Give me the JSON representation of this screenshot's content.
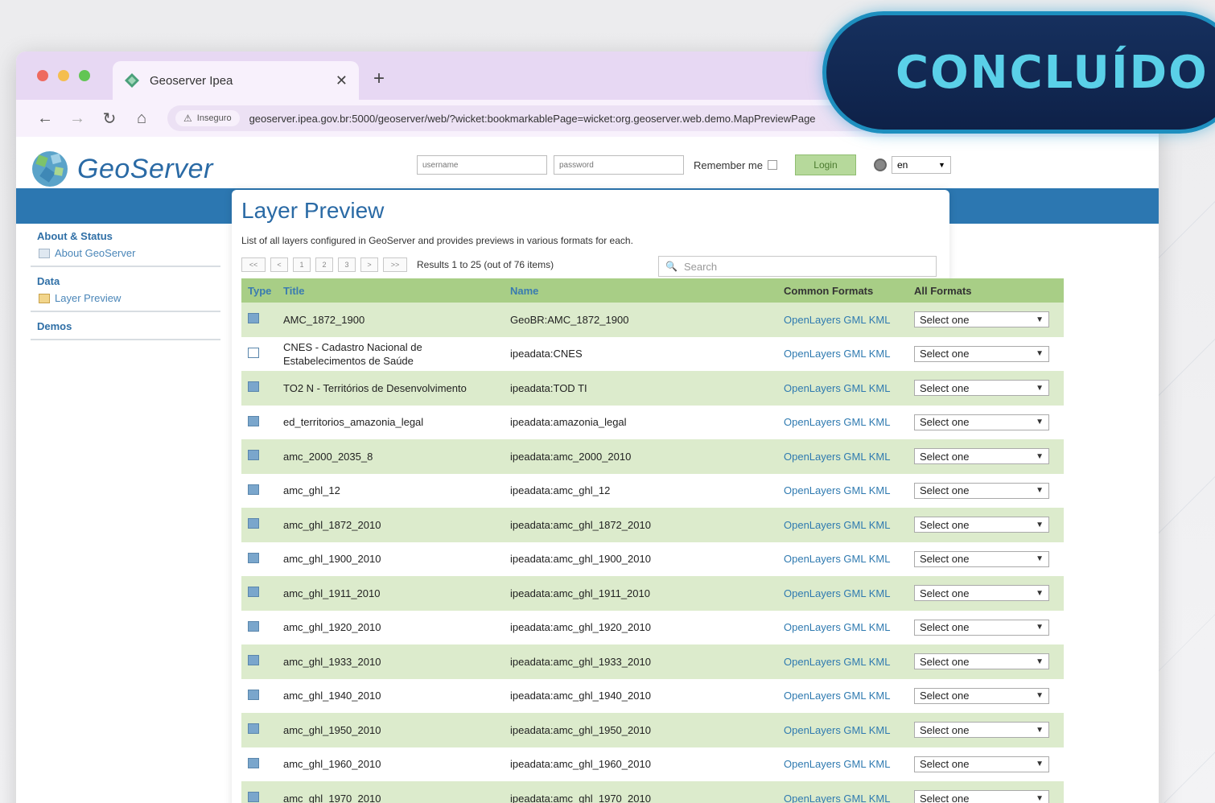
{
  "overlay": {
    "badge_text": "CONCLUÍDO"
  },
  "browser": {
    "tab_title": "Geoserver Ipea",
    "security_label": "Inseguro",
    "url": "geoserver.ipea.gov.br:5000/geoserver/web/?wicket:bookmarkablePage=wicket:org.geoserver.web.demo.MapPreviewPage"
  },
  "header": {
    "logo_text": "GeoServer",
    "username_placeholder": "username",
    "password_placeholder": "password",
    "remember_label": "Remember me",
    "login_label": "Login",
    "lang_value": "en"
  },
  "sidebar": {
    "sections": [
      {
        "title": "About & Status",
        "items": [
          "About GeoServer"
        ]
      },
      {
        "title": "Data",
        "items": [
          "Layer Preview"
        ]
      },
      {
        "title": "Demos",
        "items": []
      }
    ]
  },
  "main": {
    "title": "Layer Preview",
    "description": "List of all layers configured in GeoServer and provides previews in various formats for each.",
    "pager": {
      "buttons": [
        "<<",
        "<",
        "1",
        "2",
        "3",
        ">",
        ">>"
      ],
      "info": "Results 1 to 25 (out of 76 items)"
    },
    "search_placeholder": "Search",
    "columns": {
      "type": "Type",
      "title": "Title",
      "name": "Name",
      "common": "Common Formats",
      "all": "All Formats"
    },
    "rows": [
      {
        "title": "AMC_1872_1900",
        "name": "GeoBR:AMC_1872_1900",
        "common": "OpenLayers GML KML",
        "all": "Select one",
        "type_icon": "layer-icon"
      },
      {
        "title": "CNES - Cadastro Nacional de Estabelecimentos de Saúde",
        "name": "ipeadata:CNES",
        "common": "OpenLayers GML KML",
        "all": "Select one",
        "type_icon": "point-layer-icon"
      },
      {
        "title": "TO2 N - Territórios de Desenvolvimento",
        "name": "ipeadata:TOD TI",
        "common": "OpenLayers GML KML",
        "all": "Select one",
        "type_icon": "layer-icon"
      },
      {
        "title": "ed_territorios_amazonia_legal",
        "name": "ipeadata:amazonia_legal",
        "common": "OpenLayers GML KML",
        "all": "Select one",
        "type_icon": "layer-icon"
      },
      {
        "title": "amc_2000_2035_8",
        "name": "ipeadata:amc_2000_2010",
        "common": "OpenLayers GML KML",
        "all": "Select one",
        "type_icon": "layer-icon"
      },
      {
        "title": "amc_ghl_12",
        "name": "ipeadata:amc_ghl_12",
        "common": "OpenLayers GML KML",
        "all": "Select one",
        "type_icon": "layer-icon"
      },
      {
        "title": "amc_ghl_1872_2010",
        "name": "ipeadata:amc_ghl_1872_2010",
        "common": "OpenLayers GML KML",
        "all": "Select one",
        "type_icon": "layer-icon"
      },
      {
        "title": "amc_ghl_1900_2010",
        "name": "ipeadata:amc_ghl_1900_2010",
        "common": "OpenLayers GML KML",
        "all": "Select one",
        "type_icon": "layer-icon"
      },
      {
        "title": "amc_ghl_1911_2010",
        "name": "ipeadata:amc_ghl_1911_2010",
        "common": "OpenLayers GML KML",
        "all": "Select one",
        "type_icon": "layer-icon"
      },
      {
        "title": "amc_ghl_1920_2010",
        "name": "ipeadata:amc_ghl_1920_2010",
        "common": "OpenLayers GML KML",
        "all": "Select one",
        "type_icon": "layer-icon"
      },
      {
        "title": "amc_ghl_1933_2010",
        "name": "ipeadata:amc_ghl_1933_2010",
        "common": "OpenLayers GML KML",
        "all": "Select one",
        "type_icon": "layer-icon"
      },
      {
        "title": "amc_ghl_1940_2010",
        "name": "ipeadata:amc_ghl_1940_2010",
        "common": "OpenLayers GML KML",
        "all": "Select one",
        "type_icon": "layer-icon"
      },
      {
        "title": "amc_ghl_1950_2010",
        "name": "ipeadata:amc_ghl_1950_2010",
        "common": "OpenLayers GML KML",
        "all": "Select one",
        "type_icon": "layer-icon"
      },
      {
        "title": "amc_ghl_1960_2010",
        "name": "ipeadata:amc_ghl_1960_2010",
        "common": "OpenLayers GML KML",
        "all": "Select one",
        "type_icon": "layer-icon"
      },
      {
        "title": "amc_ghl_1970_2010",
        "name": "ipeadata:amc_ghl_1970_2010",
        "common": "OpenLayers GML KML",
        "all": "Select one",
        "type_icon": "layer-icon"
      }
    ]
  },
  "colors": {
    "header_band": "#2c77b1",
    "table_header": "#a8ce86",
    "row_alt": "#dcebcc",
    "badge_bg": "#16305e",
    "badge_text": "#5ad0e8"
  }
}
